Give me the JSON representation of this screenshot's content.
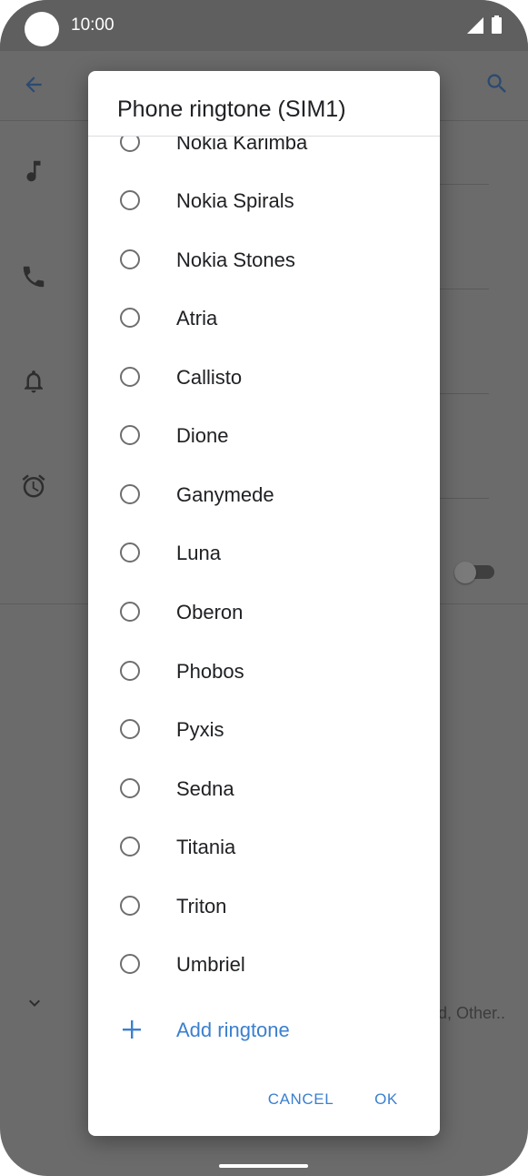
{
  "status_bar": {
    "time": "10:00"
  },
  "background": {
    "partial_text": "d, Other.."
  },
  "dialog": {
    "title": "Phone ringtone (SIM1)",
    "ringtones": [
      {
        "label": "Nokia Karimba",
        "selected": false
      },
      {
        "label": "Nokia Spirals",
        "selected": false
      },
      {
        "label": "Nokia Stones",
        "selected": false
      },
      {
        "label": "Atria",
        "selected": false
      },
      {
        "label": "Callisto",
        "selected": false
      },
      {
        "label": "Dione",
        "selected": false
      },
      {
        "label": "Ganymede",
        "selected": false
      },
      {
        "label": "Luna",
        "selected": false
      },
      {
        "label": "Oberon",
        "selected": false
      },
      {
        "label": "Phobos",
        "selected": false
      },
      {
        "label": "Pyxis",
        "selected": false
      },
      {
        "label": "Sedna",
        "selected": false
      },
      {
        "label": "Titania",
        "selected": false
      },
      {
        "label": "Triton",
        "selected": false
      },
      {
        "label": "Umbriel",
        "selected": false
      }
    ],
    "add_ringtone_label": "Add ringtone",
    "cancel_label": "CANCEL",
    "ok_label": "OK"
  },
  "colors": {
    "accent": "#3b7fcf",
    "scrim": "#6b6b6b",
    "dialog_bg": "#ffffff",
    "text_primary": "#202124",
    "radio_unchecked": "#6e6e6e"
  },
  "icons": {
    "back": "arrow-back-icon",
    "search": "search-icon",
    "music": "music-note-icon",
    "phone": "phone-icon",
    "notification": "bell-icon",
    "alarm": "alarm-icon",
    "expand": "chevron-down-icon",
    "add": "plus-icon"
  }
}
